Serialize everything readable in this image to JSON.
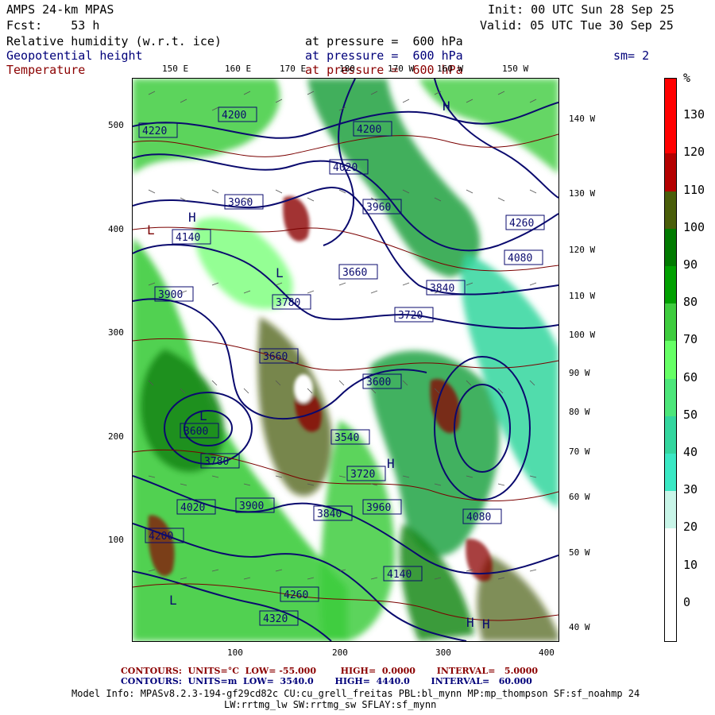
{
  "header": {
    "model": "AMPS 24-km MPAS",
    "fcst": "Fcst:    53 h",
    "init": "Init: 00 UTC Sun 28 Sep 25",
    "valid": "Valid: 05 UTC Tue 30 Sep 25",
    "field1": "Relative humidity (w.r.t. ice)",
    "field2": "Geopotential height",
    "field3": "Temperature",
    "pressure1": "at pressure =  600 hPa",
    "pressure2": "at pressure =  600 hPa",
    "pressure3": "at pressure =  600 hPa",
    "smoothing": "sm= 2"
  },
  "map": {
    "top_lon_labels": [
      "150 E",
      "160 E",
      "170 E",
      "180",
      "170 W",
      "160 W",
      "150 W"
    ],
    "right_lon_labels": [
      "140 W",
      "130 W",
      "120 W",
      "110 W",
      "100 W",
      "90 W",
      "80 W",
      "70 W",
      "60 W",
      "50 W",
      "40 W"
    ],
    "y_ticks": [
      "500",
      "400",
      "300",
      "200",
      "100"
    ],
    "x_ticks": [
      "100",
      "200",
      "300",
      "400"
    ],
    "height_labels": [
      "4200",
      "4200",
      "4220",
      "4140",
      "4260",
      "4080",
      "4020",
      "3960",
      "3960",
      "3900",
      "3840",
      "3780",
      "3720",
      "3660",
      "3600",
      "3540",
      "3600",
      "3660",
      "3720",
      "3780",
      "3840",
      "3900",
      "3960",
      "4020",
      "4080",
      "4140",
      "4200",
      "4260",
      "4320"
    ],
    "pressure_centers": [
      "H",
      "H",
      "H",
      "L",
      "L",
      "L",
      "L",
      "H",
      "H"
    ],
    "colors": {
      "height_contour": "#0a0a6e",
      "temp_contour": "#7a0000",
      "barb": "#555555"
    }
  },
  "colorbar": {
    "unit": "%",
    "labels": [
      "130",
      "120",
      "110",
      "100",
      "90",
      "80",
      "70",
      "60",
      "50",
      "40",
      "30",
      "20",
      "10",
      "0"
    ],
    "colors": [
      "#ff0000",
      "#b40000",
      "#4a5e0a",
      "#007a00",
      "#00a000",
      "#3ecc3e",
      "#66ff66",
      "#4ce67a",
      "#33d69e",
      "#3ae8c4",
      "#c8f5e8",
      "#ffffff",
      "#ffffff",
      "#ffffff"
    ]
  },
  "footer": {
    "temp_line": "CONTOURS:  UNITS=°C  LOW= -55.000        HIGH=  0.0000       INTERVAL=   5.0000",
    "height_line": "CONTOURS:  UNITS=m  LOW=  3540.0       HIGH=  4440.0       INTERVAL=   60.000",
    "model_info": "Model Info: MPASv8.2.3-194-gf29cd82c CU:cu_grell_freitas PBL:bl_mynn MP:mp_thompson SF:sf_noahmp 24",
    "model_info2": "LW:rrtmg_lw SW:rrtmg_sw SFLAY:sf_mynn"
  }
}
